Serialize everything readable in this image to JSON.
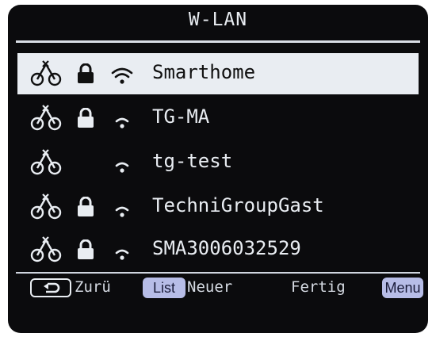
{
  "header": {
    "title": "W-LAN"
  },
  "networks": [
    {
      "ssid": "Smarthome",
      "locked": true,
      "selected": true,
      "icons": [
        "wan-disconnected-icon",
        "lock-icon",
        "wifi-signal-icon"
      ]
    },
    {
      "ssid": "TG-MA",
      "locked": true,
      "selected": false,
      "icons": [
        "wan-disconnected-icon",
        "lock-icon",
        "wifi-signal-icon"
      ]
    },
    {
      "ssid": "tg-test",
      "locked": false,
      "selected": false,
      "icons": [
        "wan-disconnected-icon",
        "wifi-signal-icon"
      ]
    },
    {
      "ssid": "TechniGroupGast",
      "locked": true,
      "selected": false,
      "icons": [
        "wan-disconnected-icon",
        "lock-icon",
        "wifi-signal-icon"
      ]
    },
    {
      "ssid": "SMA3006032529",
      "locked": true,
      "selected": false,
      "icons": [
        "wan-disconnected-icon",
        "lock-icon",
        "wifi-signal-icon"
      ]
    }
  ],
  "footer": {
    "back_label": "Zurü",
    "list_key": "List",
    "new_label": "Neuer",
    "done_label": "Fertig",
    "menu_key": "Menu"
  },
  "colors": {
    "background": "#0b0b0d",
    "text": "#e9edf2",
    "selection": "#e9edf2",
    "key": "#b7bde7"
  }
}
